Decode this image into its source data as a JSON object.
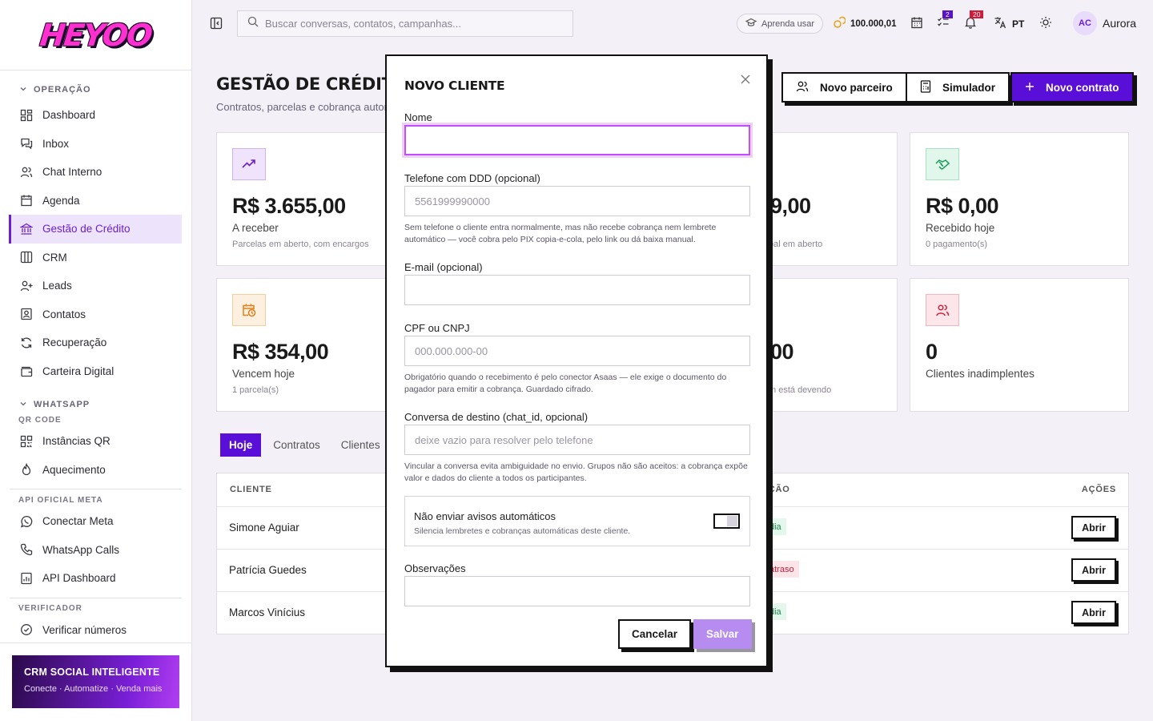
{
  "brand": {
    "logo_text": "HEYOO"
  },
  "sidebar": {
    "group_operacao": "OPERAÇÃO",
    "items_operacao": [
      {
        "label": "Dashboard",
        "icon": "dashboard-icon"
      },
      {
        "label": "Inbox",
        "icon": "inbox-icon"
      },
      {
        "label": "Chat Interno",
        "icon": "users-icon"
      },
      {
        "label": "Agenda",
        "icon": "calendar-icon"
      },
      {
        "label": "Gestão de Crédito",
        "icon": "bank-icon",
        "active": true
      },
      {
        "label": "CRM",
        "icon": "columns-icon"
      },
      {
        "label": "Leads",
        "icon": "user-plus-icon"
      },
      {
        "label": "Contatos",
        "icon": "contact-icon"
      },
      {
        "label": "Recuperação",
        "icon": "refresh-icon"
      },
      {
        "label": "Carteira Digital",
        "icon": "wallet-icon"
      }
    ],
    "group_whatsapp": "WHATSAPP",
    "sub_qr": "QR CODE",
    "items_qr": [
      {
        "label": "Instâncias QR",
        "icon": "qr-icon"
      },
      {
        "label": "Aquecimento",
        "icon": "flame-icon"
      }
    ],
    "sub_api": "API OFICIAL META",
    "items_api": [
      {
        "label": "Conectar Meta",
        "icon": "whatsapp-icon"
      },
      {
        "label": "WhatsApp Calls",
        "icon": "phone-icon"
      },
      {
        "label": "API Dashboard",
        "icon": "chart-icon"
      }
    ],
    "sub_verif": "VERIFICADOR",
    "items_verif": [
      {
        "label": "Verificar números",
        "icon": "check-circle-icon"
      }
    ],
    "promo_title": "CRM SOCIAL INTELIGENTE",
    "promo_sub": "Conecte · Automatize · Venda mais"
  },
  "topbar": {
    "search_placeholder": "Buscar conversas, contatos, campanhas...",
    "learn_label": "Aprenda usar",
    "credits": "100.000,01",
    "tasks_badge": "2",
    "notif_badge": "20",
    "lang": "PT",
    "avatar_initials": "AC",
    "user_name": "Aurora"
  },
  "page": {
    "title": "GESTÃO DE CRÉDITO",
    "subtitle": "Contratos, parcelas e cobrança autom",
    "btn_partner": "Novo parceiro",
    "btn_simulator": "Simulador",
    "btn_contract": "Novo contrato"
  },
  "cards": [
    {
      "value": "R$ 3.655,00",
      "label": "A receber",
      "sub": "Parcelas em aberto, com encargos"
    },
    {
      "value": "9,00",
      "label": "",
      "sub": "pal em aberto"
    },
    {
      "value": "R$ 0,00",
      "label": "Recebido hoje",
      "sub": "0 pagamento(s)"
    },
    {
      "value": "R$ 354,00",
      "label": "Vencem hoje",
      "sub": "1 parcela(s)"
    },
    {
      "value": "00",
      "label": "",
      "sub": "m está devendo"
    },
    {
      "value": "0",
      "label": "Clientes inadimplentes",
      "sub": ""
    }
  ],
  "tabs": [
    "Hoje",
    "Contratos",
    "Clientes"
  ],
  "table": {
    "col_client": "CLIENTE",
    "col_status": "AÇÃO",
    "col_actions": "AÇÕES",
    "rows": [
      {
        "client": "Simone Aguiar",
        "status": "dia",
        "action": "Abrir"
      },
      {
        "client": "Patrícia Guedes",
        "status": "atraso",
        "action": "Abrir"
      },
      {
        "client": "Marcos Vinícius",
        "status": "dia",
        "action": "Abrir"
      }
    ]
  },
  "modal": {
    "title": "NOVO CLIENTE",
    "name_label": "Nome",
    "name_value": "",
    "phone_label": "Telefone com DDD (opcional)",
    "phone_placeholder": "5561999990000",
    "phone_help": "Sem telefone o cliente entra normalmente, mas não recebe cobrança nem lembrete automático — você cobra pelo PIX copia-e-cola, pelo link ou dá baixa manual.",
    "email_label": "E-mail (opcional)",
    "email_placeholder": "",
    "doc_label": "CPF ou CNPJ",
    "doc_placeholder": "000.000.000-00",
    "doc_help": "Obrigatório quando o recebimento é pelo conector Asaas — ele exige o documento do pagador para emitir a cobrança. Guardado cifrado.",
    "chat_label": "Conversa de destino (chat_id, opcional)",
    "chat_placeholder": "deixe vazio para resolver pelo telefone",
    "chat_help": "Vincular a conversa evita ambiguidade no envio. Grupos não são aceitos: a cobrança expõe valor e dados do cliente a todos os participantes.",
    "toggle_title": "Não enviar avisos automáticos",
    "toggle_sub": "Silencia lembretes e cobranças automáticas deste cliente.",
    "toggle_on": false,
    "obs_label": "Observações",
    "cancel": "Cancelar",
    "save": "Salvar"
  }
}
